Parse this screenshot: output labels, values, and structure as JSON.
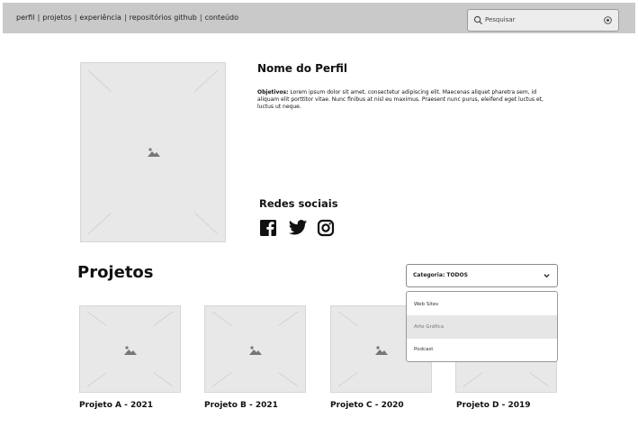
{
  "nav": {
    "items": [
      "perfil",
      "projetos",
      "experiência",
      "repositórios github",
      "conteúdo"
    ],
    "separator": "|"
  },
  "search": {
    "placeholder": "Pesquisar",
    "search_icon": "search-icon",
    "location_icon": "location-icon"
  },
  "profile": {
    "name": "Nome do Perfil",
    "objectives_label": "Objetivos:",
    "objectives_text": " Lorem ipsum dolor sit amet, consectetur adipiscing elit. Maecenas aliquet pharetra sem, id aliquam elit porttitor vitae. Nunc finibus at nisl eu maximus. Praesent nunc purus, eleifend eget luctus et, luctus ut neque."
  },
  "social": {
    "title": "Redes sociais",
    "icons": [
      "facebook-icon",
      "twitter-icon",
      "instagram-icon"
    ]
  },
  "projects": {
    "title": "Projetos",
    "category_label": "Categoria: TODOS",
    "dropdown_options": [
      "Web Sites",
      "Arte Gráfica",
      "Podcast"
    ],
    "highlighted_option": "Arte Gráfica",
    "items": [
      {
        "title": "Projeto A - 2021"
      },
      {
        "title": "Projeto B - 2021"
      },
      {
        "title": "Projeto C - 2020"
      },
      {
        "title": "Projeto D - 2019"
      }
    ]
  },
  "colors": {
    "topbar": "#c9c9c9",
    "placeholder": "#e8e8e8",
    "highlight": "#e6e6e6"
  }
}
